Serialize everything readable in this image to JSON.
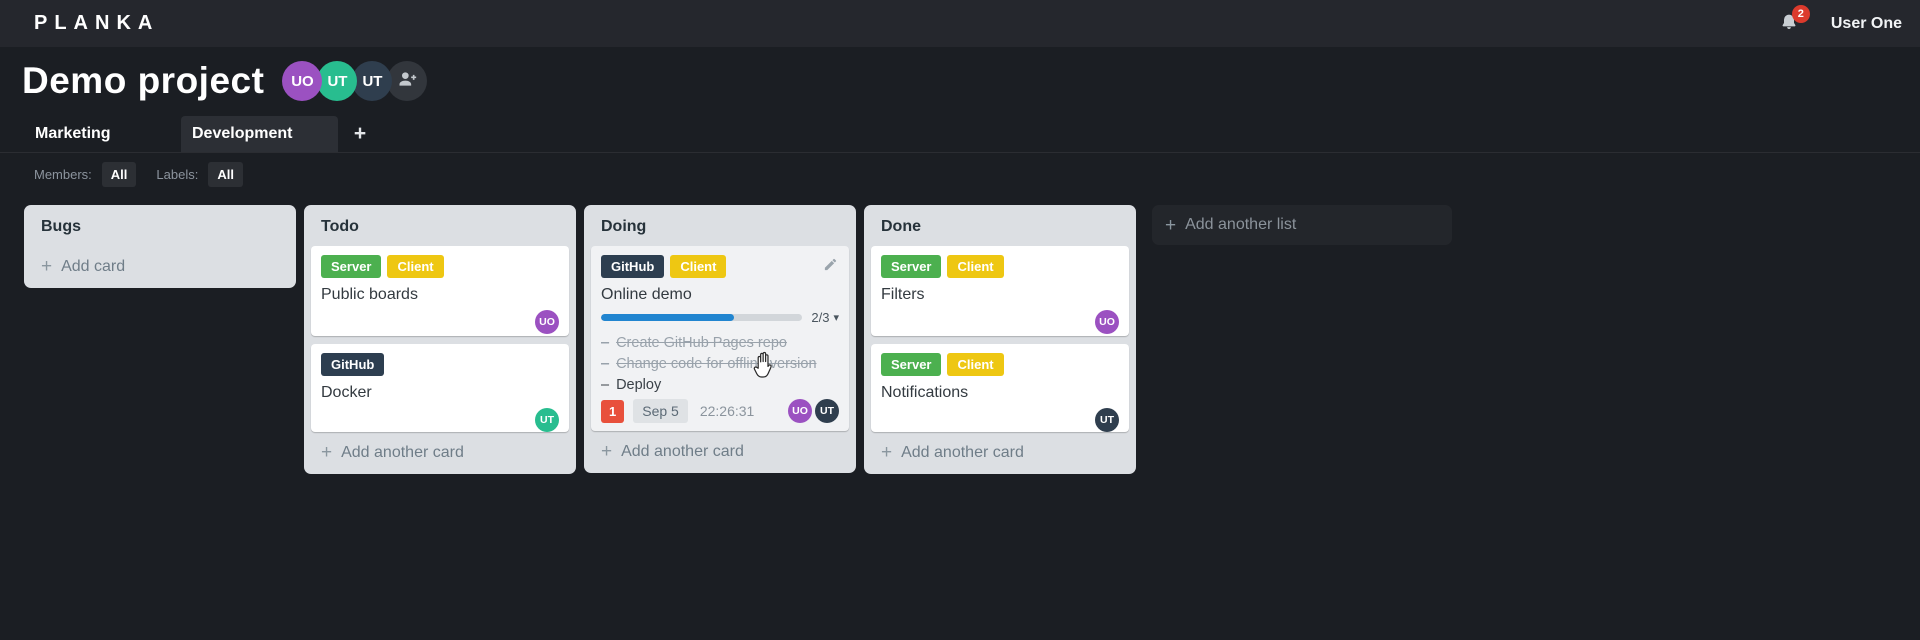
{
  "header": {
    "logo": "PLANKA",
    "notification_count": "2",
    "user_name": "User One"
  },
  "project": {
    "title": "Demo project",
    "members": [
      {
        "initials": "UO",
        "color": "#9b51c1"
      },
      {
        "initials": "UT",
        "color": "#28bd8f"
      },
      {
        "initials": "UT",
        "color": "#2f3e4e"
      }
    ]
  },
  "tabs": {
    "items": [
      {
        "label": "Marketing"
      },
      {
        "label": "Development"
      }
    ],
    "active": "Development",
    "add_label": "+"
  },
  "filters": {
    "members_label": "Members:",
    "members_value": "All",
    "labels_label": "Labels:",
    "labels_value": "All"
  },
  "board": {
    "lists": [
      {
        "title": "Bugs",
        "add_label": "Add card",
        "cards": []
      },
      {
        "title": "Todo",
        "add_label": "Add another card",
        "cards": [
          {
            "title": "Public boards",
            "labels": [
              {
                "text": "Server",
                "color": "#4cb04f"
              },
              {
                "text": "Client",
                "color": "#eec712"
              }
            ],
            "members": [
              {
                "initials": "UO",
                "color": "#9b51c1"
              }
            ]
          },
          {
            "title": "Docker",
            "labels": [
              {
                "text": "GitHub",
                "color": "#2d3e50"
              }
            ],
            "members": [
              {
                "initials": "UT",
                "color": "#28bd8f"
              }
            ]
          }
        ]
      },
      {
        "title": "Doing",
        "add_label": "Add another card",
        "cards": [
          {
            "title": "Online demo",
            "labels": [
              {
                "text": "GitHub",
                "color": "#2d3e50"
              },
              {
                "text": "Client",
                "color": "#eec712"
              }
            ],
            "progress": {
              "completed": 2,
              "total": 3,
              "text": "2/3",
              "percent": 66,
              "percent_css": "66%",
              "color": "#2185d0"
            },
            "tasks": [
              {
                "text": "Create GitHub Pages repo",
                "done": true
              },
              {
                "text": "Change code for offline version",
                "done": true
              },
              {
                "text": "Deploy",
                "done": false
              }
            ],
            "notification_count": "1",
            "due_date": "Sep 5",
            "timer": "22:26:31",
            "members": [
              {
                "initials": "UO",
                "color": "#9b51c1"
              },
              {
                "initials": "UT",
                "color": "#2f3e4e"
              }
            ]
          }
        ]
      },
      {
        "title": "Done",
        "add_label": "Add another card",
        "cards": [
          {
            "title": "Filters",
            "labels": [
              {
                "text": "Server",
                "color": "#4cb04f"
              },
              {
                "text": "Client",
                "color": "#eec712"
              }
            ],
            "members": [
              {
                "initials": "UO",
                "color": "#9b51c1"
              }
            ]
          },
          {
            "title": "Notifications",
            "labels": [
              {
                "text": "Server",
                "color": "#4cb04f"
              },
              {
                "text": "Client",
                "color": "#eec712"
              }
            ],
            "members": [
              {
                "initials": "UT",
                "color": "#2f3e4e"
              }
            ]
          }
        ]
      }
    ],
    "add_list_label": "Add another list"
  },
  "icons": {
    "plus": "+",
    "caret_down": "▾",
    "dash": "–"
  },
  "colors": {
    "topbar_bg": "#25272d",
    "page_bg": "#1b1e23",
    "list_bg": "#dcdfe3",
    "card_bg": "#ffffff",
    "accent_blue": "#2185d0",
    "badge_red": "#dc3a2c",
    "notif_red": "#e8503c"
  }
}
